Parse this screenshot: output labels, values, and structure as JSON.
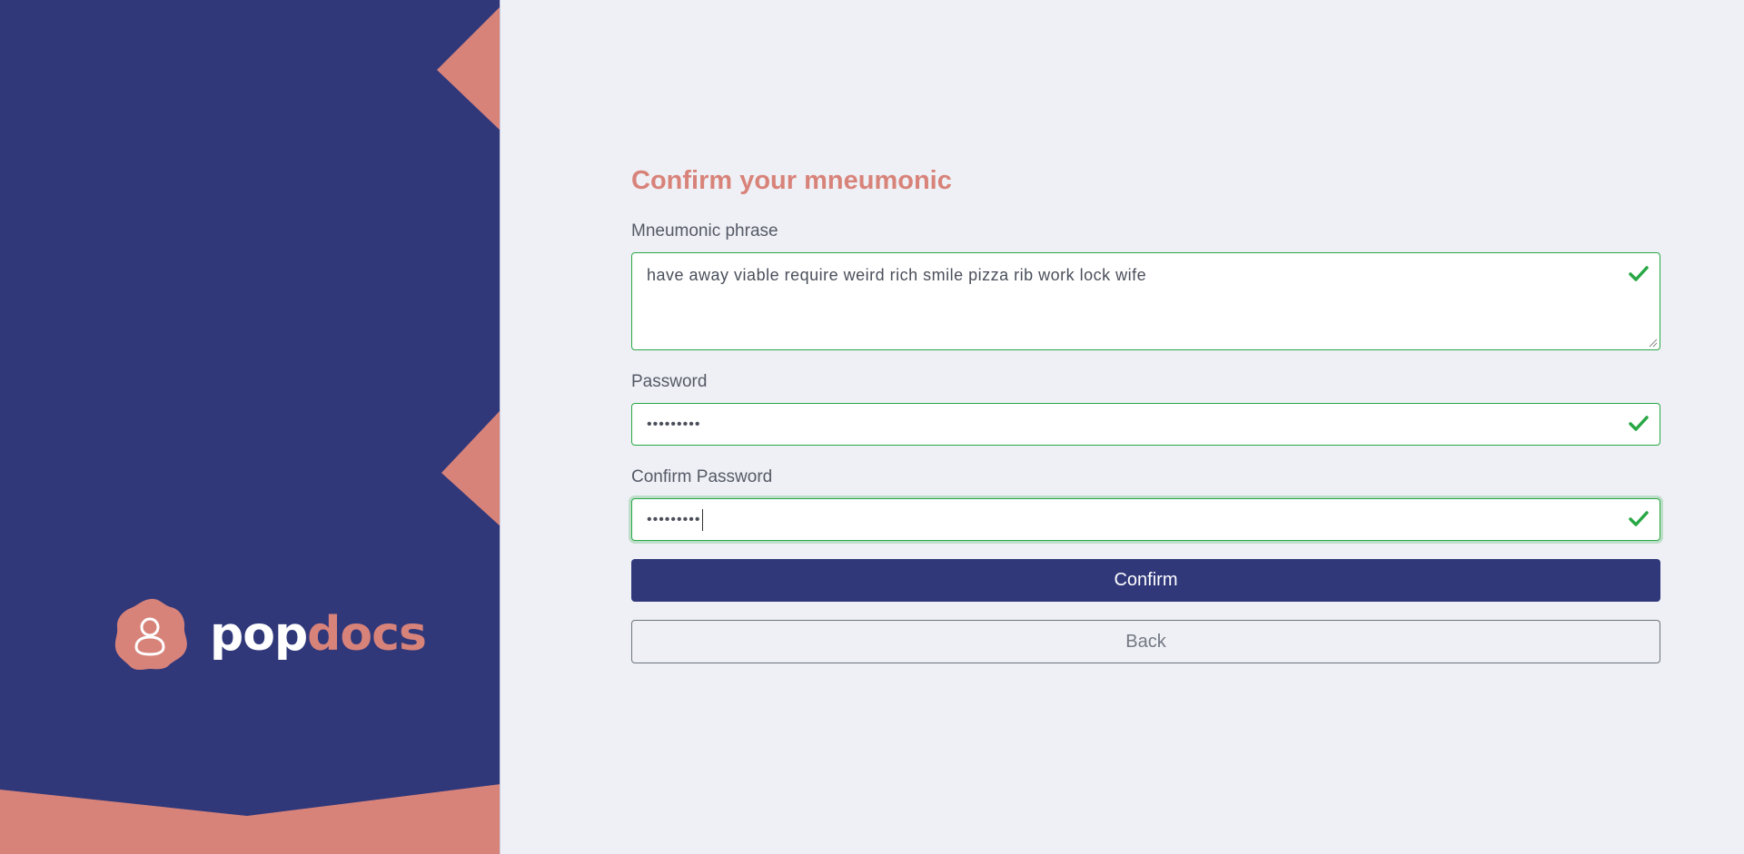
{
  "brand": {
    "logo_part1": "pop",
    "logo_part2": "docs",
    "colors": {
      "panel": "#30387a",
      "accent": "#d8837a"
    }
  },
  "form": {
    "title": "Confirm your mneumonic",
    "mnemonic": {
      "label": "Mneumonic phrase",
      "value": "have away viable require weird rich smile pizza rib work lock wife",
      "valid": true
    },
    "password": {
      "label": "Password",
      "masked_value": "•••••••••",
      "valid": true
    },
    "confirm_password": {
      "label": "Confirm Password",
      "masked_value": "•••••••••",
      "valid": true,
      "focused": true
    },
    "confirm_button": "Confirm",
    "back_button": "Back",
    "icons": {
      "valid": "check-icon",
      "brand": "user-blob-icon"
    },
    "colors": {
      "valid": "#28a745",
      "title": "#d8837a",
      "primary": "#30387a"
    }
  }
}
